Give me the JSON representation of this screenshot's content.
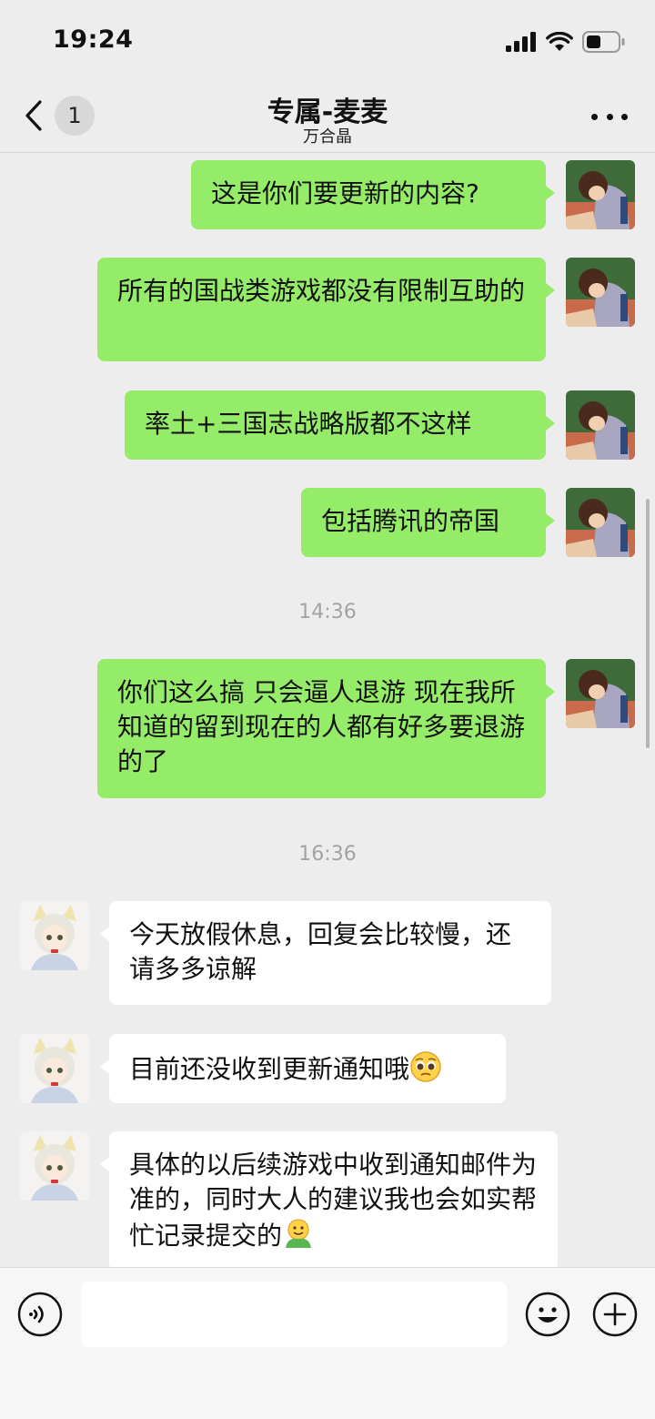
{
  "status_bar": {
    "time": "19:24"
  },
  "nav": {
    "back_badge": "1",
    "title": "专属-麦麦",
    "subtitle": "万合晶",
    "more_icon": "more-dots-icon"
  },
  "messages": [
    {
      "side": "right",
      "text": "这是你们要更新的内容?"
    },
    {
      "side": "right",
      "text": "所有的国战类游戏都没有限制互助的"
    },
    {
      "side": "right",
      "text": "率土+三国志战略版都不这样"
    },
    {
      "side": "right",
      "text": "包括腾讯的帝国"
    },
    {
      "timestamp": "14:36"
    },
    {
      "side": "right",
      "text": "你们这么搞 只会逼人退游 现在我所知道的留到现在的人都有好多要退游的了"
    },
    {
      "timestamp": "16:36"
    },
    {
      "side": "left",
      "text": "今天放假休息，回复会比较慢，还请多多谅解"
    },
    {
      "side": "left",
      "text": "目前还没收到更新通知哦",
      "emoji": "pleading-face-emoji"
    },
    {
      "side": "left",
      "text": "具体的以后续游戏中收到通知邮件为准的，同时大人的建议我也会如实帮忙记录提交的",
      "emoji": "hug-emoji"
    }
  ],
  "input": {
    "value": "",
    "voice_icon": "voice-icon",
    "emoji_icon": "emoji-icon",
    "plus_icon": "plus-icon"
  },
  "colors": {
    "sent_bubble": "#95ec69",
    "received_bubble": "#ffffff",
    "background": "#ededed"
  }
}
